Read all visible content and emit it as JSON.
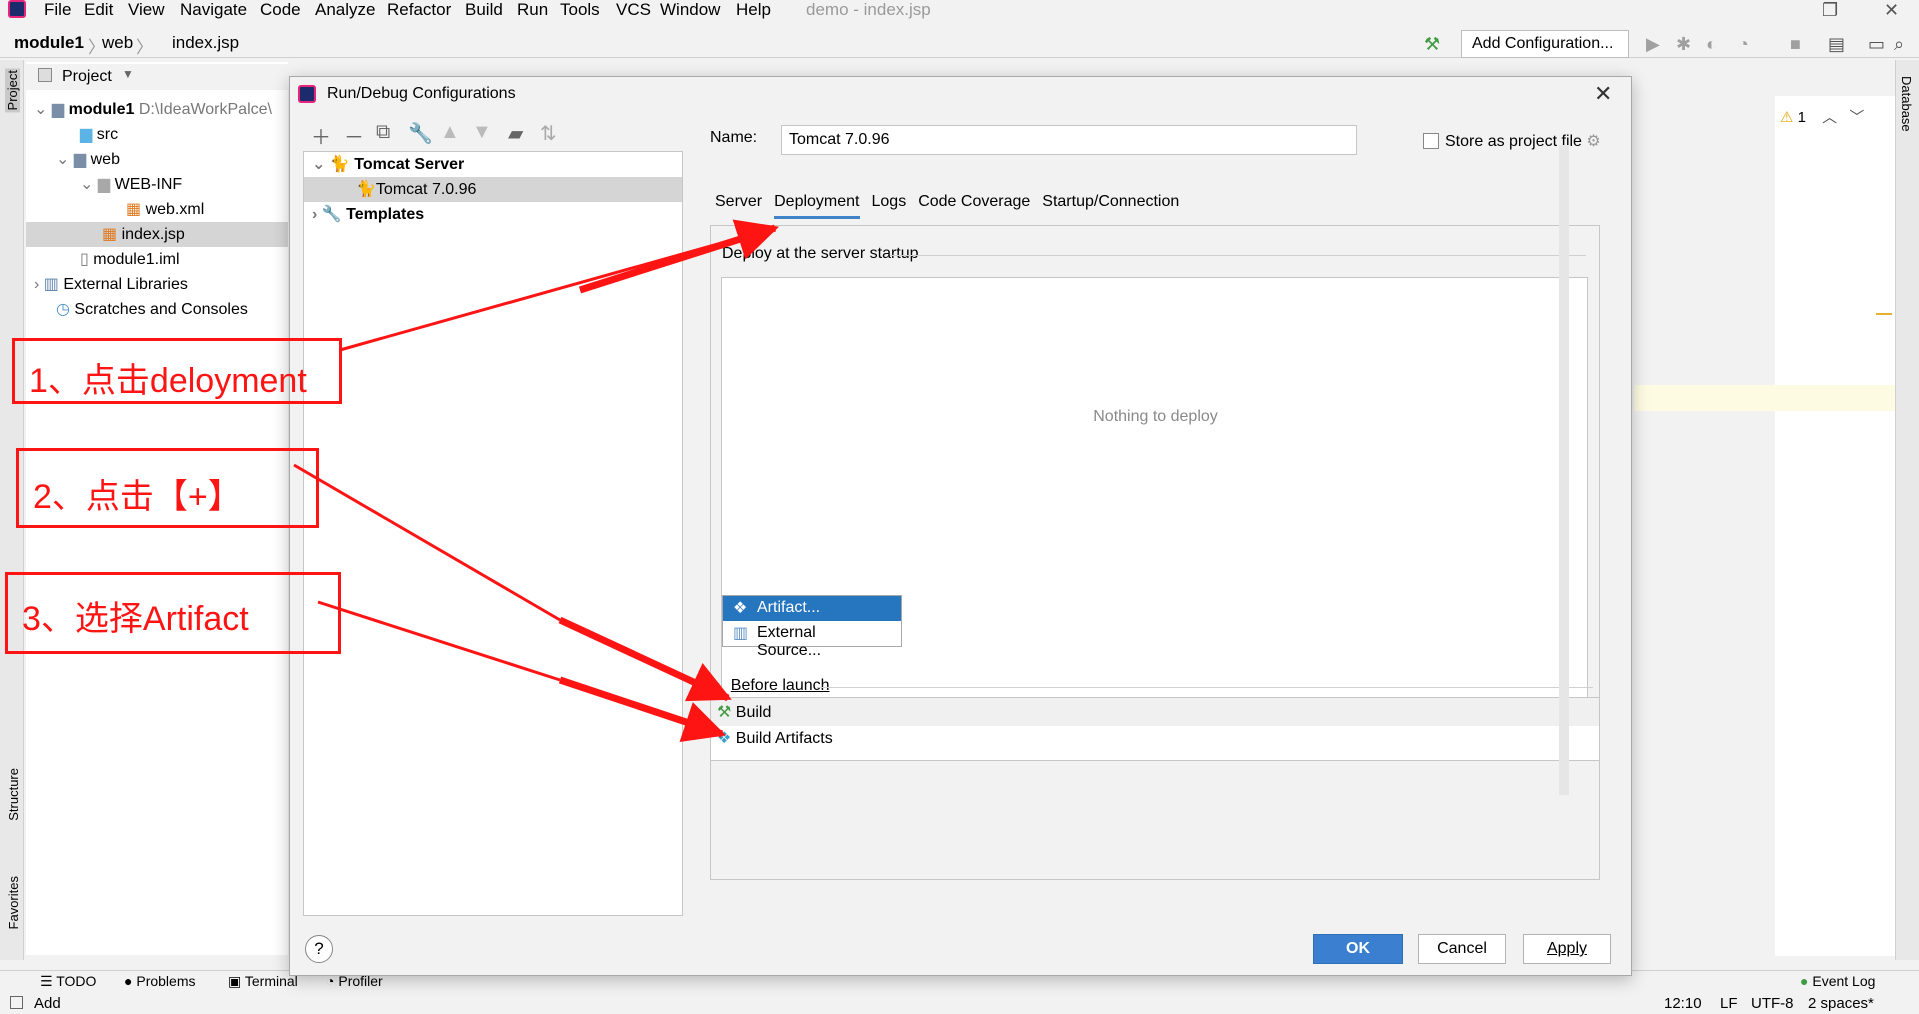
{
  "menubar": {
    "items": [
      "File",
      "Edit",
      "View",
      "Navigate",
      "Code",
      "Analyze",
      "Refactor",
      "Build",
      "Run",
      "Tools",
      "VCS",
      "Window",
      "Help"
    ],
    "window_title": "demo - index.jsp"
  },
  "breadcrumb": {
    "module": "module1",
    "folder": "web",
    "file": "index.jsp"
  },
  "toolbar": {
    "add_configuration": "Add Configuration..."
  },
  "project_panel": {
    "title": "Project",
    "tree": [
      {
        "label": "module1",
        "detail": "D:\\IdeaWorkPalce\\"
      },
      {
        "label": "src"
      },
      {
        "label": "web"
      },
      {
        "label": "WEB-INF"
      },
      {
        "label": "web.xml"
      },
      {
        "label": "index.jsp"
      },
      {
        "label": "module1.iml"
      },
      {
        "label": "External Libraries"
      },
      {
        "label": "Scratches and Consoles"
      }
    ]
  },
  "left_strip": {
    "project": "Project",
    "structure": "Structure",
    "favorites": "Favorites"
  },
  "right_strip": {
    "database": "Database"
  },
  "editor": {
    "warning_count": "1"
  },
  "dialog": {
    "title": "Run/Debug Configurations",
    "tree": {
      "server": "Tomcat Server",
      "config": "Tomcat 7.0.96",
      "templates": "Templates"
    },
    "name_label": "Name:",
    "name_value": "Tomcat 7.0.96",
    "store_label": "Store as project file",
    "tabs": [
      "Server",
      "Deployment",
      "Logs",
      "Code Coverage",
      "Startup/Connection"
    ],
    "deploy_label": "Deploy at the server startup",
    "empty_text": "Nothing to deploy",
    "popup": [
      "Artifact...",
      "External Source..."
    ],
    "before_launch": "Before launch",
    "before_items": [
      "Build",
      "Build Artifacts"
    ],
    "buttons": {
      "ok": "OK",
      "cancel": "Cancel",
      "apply": "Apply",
      "help": "?"
    }
  },
  "annotations": [
    "1、点击deloyment",
    "2、点击【+】",
    "3、选择Artifact"
  ],
  "bottom_tools": [
    "TODO",
    "Problems",
    "Terminal",
    "Profiler",
    "Event Log"
  ],
  "status": {
    "left": "Add",
    "position": "12:10",
    "line_sep": "LF",
    "encoding": "UTF-8",
    "indent": "2 spaces*"
  },
  "colors": {
    "accent": "#3a7fd0",
    "annotation": "#ff1414",
    "selection": "#2675bf"
  }
}
